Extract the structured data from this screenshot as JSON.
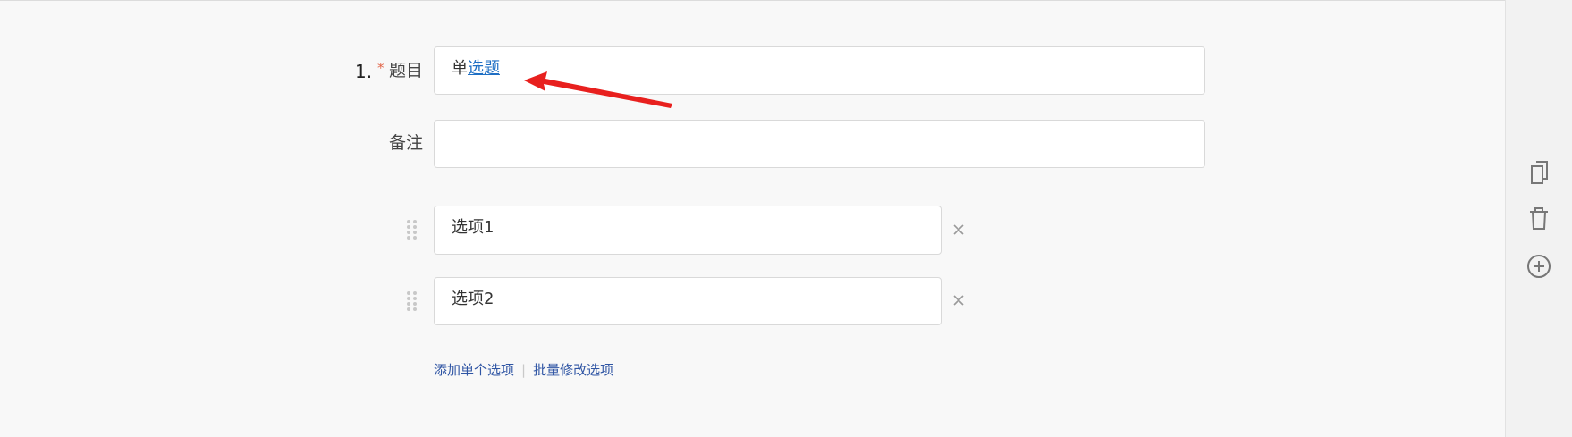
{
  "question": {
    "number": "1.",
    "required_mark": "*",
    "title_label": "题目",
    "title_value_prefix": "单",
    "title_value_link": "选题",
    "note_label": "备注",
    "note_value": ""
  },
  "options": [
    {
      "label": "选项1"
    },
    {
      "label": "选项2"
    }
  ],
  "actions": {
    "add_single": "添加单个选项",
    "separator": "|",
    "batch_edit": "批量修改选项"
  },
  "icons": {
    "copy": "copy-icon",
    "delete": "trash-icon",
    "add": "plus-circle-icon",
    "drag": "drag-handle-icon",
    "remove": "close-icon"
  },
  "colors": {
    "required": "#e2664a",
    "link": "#2f55a4",
    "arrow": "#e8201e"
  }
}
